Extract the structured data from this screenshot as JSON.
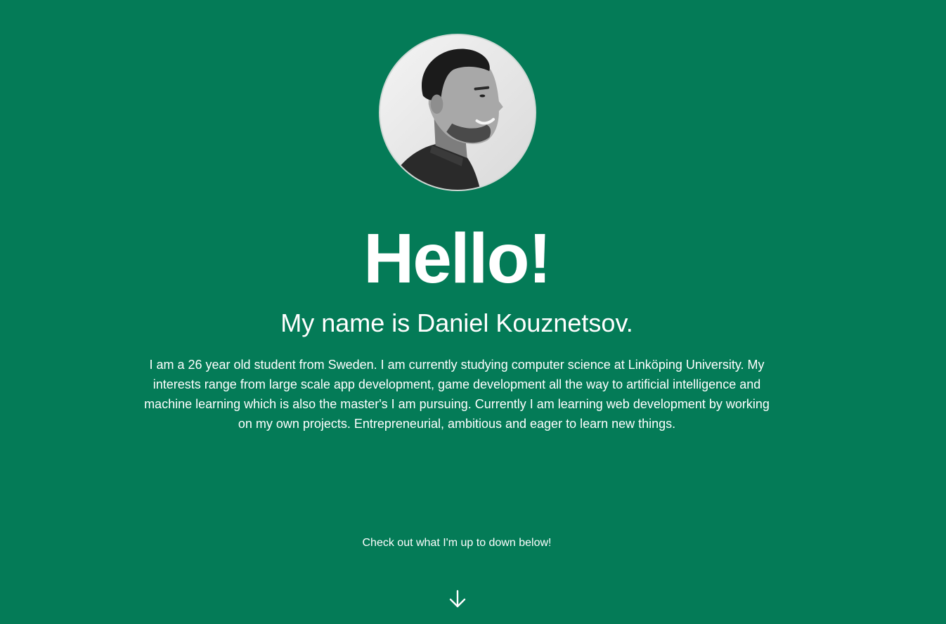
{
  "profile": {
    "photo_icon": "profile-photo",
    "greeting": "Hello!",
    "name_line": "My name is Daniel Kouznetsov.",
    "bio": "I am a 26 year old student from Sweden. I am currently studying computer science at Linköping University. My interests range from large scale app development, game development all the way to artificial intelligence and machine learning which is also the master's I am pursuing. Currently I am learning web development by working on my own projects. Entrepreneurial, ambitious and eager to learn new things.",
    "cta": "Check out what I'm up to down below!",
    "scroll_icon": "arrow-down-icon"
  },
  "colors": {
    "background": "#047b57",
    "text": "#ffffff"
  }
}
